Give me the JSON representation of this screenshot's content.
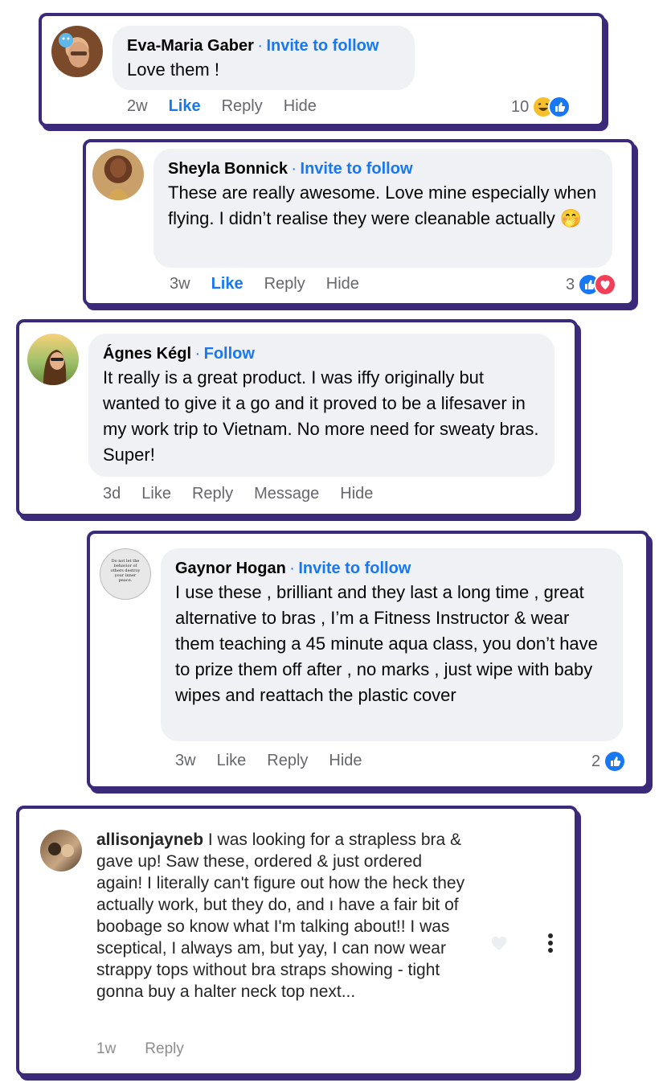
{
  "comments": [
    {
      "name": "Eva-Maria Gaber",
      "separator": "·",
      "follow_label": "Invite to follow",
      "text": "Love them !",
      "time": "2w",
      "actions": [
        "Like",
        "Reply",
        "Hide"
      ],
      "reaction_count": "10",
      "reactions": [
        "haha-icon",
        "like-icon"
      ]
    },
    {
      "name": "Sheyla Bonnick",
      "separator": "·",
      "follow_label": "Invite to follow",
      "text": "These are really awesome. Love mine especially when flying. I didn’t realise they were cleanable actually 🤭",
      "time": "3w",
      "actions": [
        "Like",
        "Reply",
        "Hide"
      ],
      "reaction_count": "3",
      "reactions": [
        "like-icon",
        "love-icon"
      ]
    },
    {
      "name": "Ágnes Kégl",
      "separator": "·",
      "follow_label": "Follow",
      "text": "It really is a great product. I was iffy originally but wanted to give it a go and it proved to be a lifesaver in my work trip to Vietnam. No more need for sweaty bras. Super!",
      "time": "3d",
      "actions": [
        "Like",
        "Reply",
        "Message",
        "Hide"
      ]
    },
    {
      "name": "Gaynor Hogan",
      "separator": "·",
      "follow_label": "Invite to follow",
      "avatar_text": "Do not let the behavior of others destroy your inner peace.",
      "text": "I use these , brilliant and they last a long time , great alternative to bras , I’m a Fitness Instructor & wear them teaching a 45 minute aqua class, you don’t have to prize them off after , no marks , just wipe with baby wipes and reattach the plastic cover",
      "time": "3w",
      "actions": [
        "Like",
        "Reply",
        "Hide"
      ],
      "reaction_count": "2",
      "reactions": [
        "like-icon"
      ]
    }
  ],
  "instagram_comment": {
    "username": "allisonjayneb",
    "text": "I was looking for a strapless bra & gave up! Saw these, ordered & just ordered again! I literally can't figure out how the heck they actually work, but they do, and ı have a fair bit of boobage so know what I'm talking about!! I was sceptical, I always am, but yay, I can now wear strappy tops without bra straps showing - tight gonna buy a halter neck top next...",
    "time": "1w",
    "reply_label": "Reply",
    "icons": [
      "heart-icon",
      "more-options-icon"
    ]
  },
  "colors": {
    "border": "#3b2a7a",
    "link": "#1877f2",
    "bubble": "#eff1f5",
    "muted": "#65676b"
  }
}
